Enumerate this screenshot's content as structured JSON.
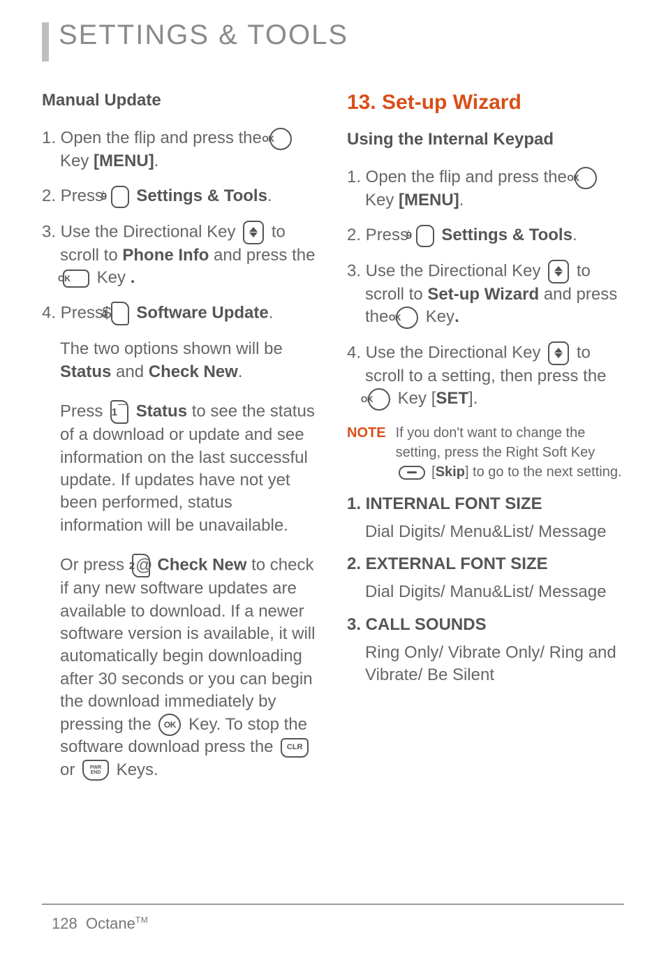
{
  "page_title": "SETTINGS & TOOLS",
  "left": {
    "heading": "Manual Update",
    "step1a": "1. Open the flip and press the ",
    "step1b": "Key ",
    "menu": "[MENU]",
    "period": ".",
    "step2a": "2. Press ",
    "settings_tools": "Settings & Tools",
    "step3a": "3. Use the Directional Key ",
    "step3b": " to scroll to ",
    "phone_info": "Phone Info",
    "step3c": " and press the ",
    "step3d": " Key ",
    "step4a": "4. Press ",
    "software_update": "Software Update",
    "para1a": "The two options shown will be ",
    "status": "Status",
    "para1b": " and ",
    "check_new": "Check New",
    "para2a": "Press ",
    "para2b": " to see the status of a download or update and see information on the last successful update. If updates have not yet been performed, status information will be unavailable.",
    "para3a": "Or press ",
    "para3b": " to check if any new software updates are available to download. If a newer software version is available, it will automatically begin downloading after 30 seconds or you can begin the download immediately by pressing the ",
    "para3c": " Key. To stop the software download press the ",
    "para3d": " or ",
    "para3e": " Keys."
  },
  "right": {
    "section": "13. Set-up Wizard",
    "heading": "Using the Internal Keypad",
    "step1a": "1. Open the flip and press the ",
    "step1b": "Key ",
    "menu": "[MENU]",
    "period": ".",
    "step2a": "2. Press ",
    "settings_tools": "Settings & Tools",
    "step3a": "3. Use the Directional Key ",
    "step3b": " to scroll to ",
    "setup_wizard": "Set-up Wizard",
    "step3c": " and press the ",
    "step3d": " Key",
    "step4a": "4. Use the Directional Key ",
    "step4b": " to scroll to a setting, then press the ",
    "step4c": " Key [",
    "set": "SET",
    "step4d": "].",
    "note_label": "NOTE",
    "note_a": "If you don't want to change the setting, press the Right Soft Key ",
    "note_b": " [",
    "skip": "Skip",
    "note_c": "] to go to the next setting.",
    "s1_head": "1. INTERNAL FONT SIZE",
    "s1_opts": "Dial Digits/ Menu&List/ Message",
    "s2_head": "2. EXTERNAL FONT SIZE",
    "s2_opts": "Dial Digits/ Manu&List/ Message",
    "s3_head": "3. CALL SOUNDS",
    "s3_opts": "Ring Only/ Vibrate Only/ Ring and Vibrate/ Be Silent"
  },
  "footer": {
    "page_number": "128",
    "model": "Octane",
    "tm": "TM"
  },
  "icons": {
    "ok": "OK",
    "nine": "9",
    "four": "4",
    "one": "1",
    "two": "2",
    "clr": "CLR",
    "pwr": "PWR",
    "end": "END"
  }
}
